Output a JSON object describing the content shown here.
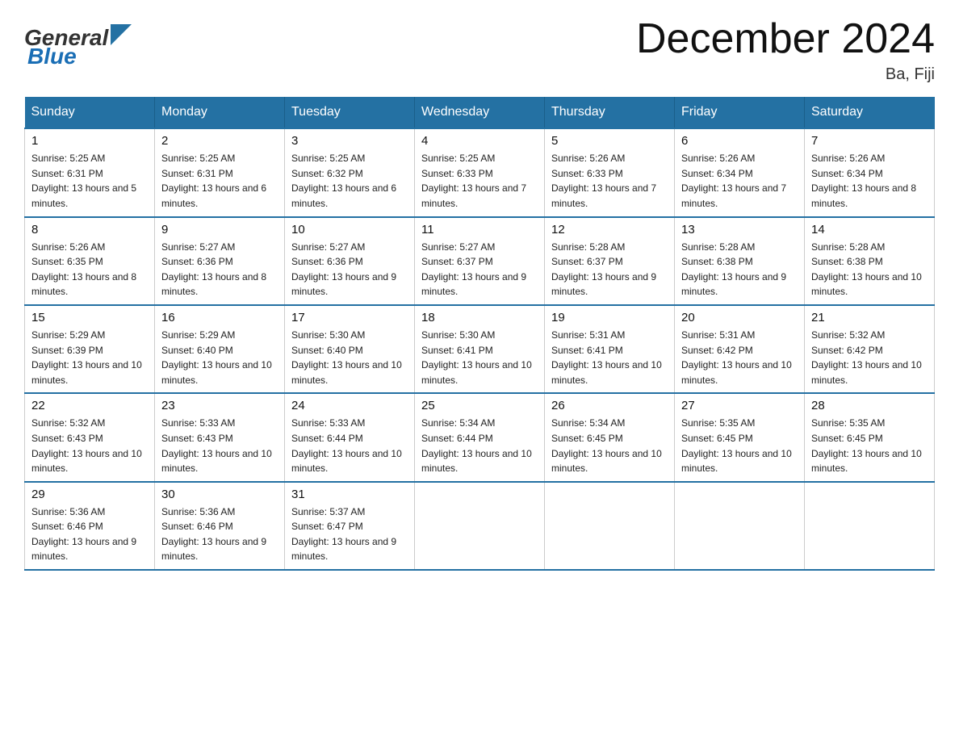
{
  "header": {
    "logo_general": "General",
    "logo_blue": "Blue",
    "title": "December 2024",
    "subtitle": "Ba, Fiji"
  },
  "days_of_week": [
    "Sunday",
    "Monday",
    "Tuesday",
    "Wednesday",
    "Thursday",
    "Friday",
    "Saturday"
  ],
  "weeks": [
    [
      {
        "day": "1",
        "sunrise": "5:25 AM",
        "sunset": "6:31 PM",
        "daylight": "13 hours and 5 minutes."
      },
      {
        "day": "2",
        "sunrise": "5:25 AM",
        "sunset": "6:31 PM",
        "daylight": "13 hours and 6 minutes."
      },
      {
        "day": "3",
        "sunrise": "5:25 AM",
        "sunset": "6:32 PM",
        "daylight": "13 hours and 6 minutes."
      },
      {
        "day": "4",
        "sunrise": "5:25 AM",
        "sunset": "6:33 PM",
        "daylight": "13 hours and 7 minutes."
      },
      {
        "day": "5",
        "sunrise": "5:26 AM",
        "sunset": "6:33 PM",
        "daylight": "13 hours and 7 minutes."
      },
      {
        "day": "6",
        "sunrise": "5:26 AM",
        "sunset": "6:34 PM",
        "daylight": "13 hours and 7 minutes."
      },
      {
        "day": "7",
        "sunrise": "5:26 AM",
        "sunset": "6:34 PM",
        "daylight": "13 hours and 8 minutes."
      }
    ],
    [
      {
        "day": "8",
        "sunrise": "5:26 AM",
        "sunset": "6:35 PM",
        "daylight": "13 hours and 8 minutes."
      },
      {
        "day": "9",
        "sunrise": "5:27 AM",
        "sunset": "6:36 PM",
        "daylight": "13 hours and 8 minutes."
      },
      {
        "day": "10",
        "sunrise": "5:27 AM",
        "sunset": "6:36 PM",
        "daylight": "13 hours and 9 minutes."
      },
      {
        "day": "11",
        "sunrise": "5:27 AM",
        "sunset": "6:37 PM",
        "daylight": "13 hours and 9 minutes."
      },
      {
        "day": "12",
        "sunrise": "5:28 AM",
        "sunset": "6:37 PM",
        "daylight": "13 hours and 9 minutes."
      },
      {
        "day": "13",
        "sunrise": "5:28 AM",
        "sunset": "6:38 PM",
        "daylight": "13 hours and 9 minutes."
      },
      {
        "day": "14",
        "sunrise": "5:28 AM",
        "sunset": "6:38 PM",
        "daylight": "13 hours and 10 minutes."
      }
    ],
    [
      {
        "day": "15",
        "sunrise": "5:29 AM",
        "sunset": "6:39 PM",
        "daylight": "13 hours and 10 minutes."
      },
      {
        "day": "16",
        "sunrise": "5:29 AM",
        "sunset": "6:40 PM",
        "daylight": "13 hours and 10 minutes."
      },
      {
        "day": "17",
        "sunrise": "5:30 AM",
        "sunset": "6:40 PM",
        "daylight": "13 hours and 10 minutes."
      },
      {
        "day": "18",
        "sunrise": "5:30 AM",
        "sunset": "6:41 PM",
        "daylight": "13 hours and 10 minutes."
      },
      {
        "day": "19",
        "sunrise": "5:31 AM",
        "sunset": "6:41 PM",
        "daylight": "13 hours and 10 minutes."
      },
      {
        "day": "20",
        "sunrise": "5:31 AM",
        "sunset": "6:42 PM",
        "daylight": "13 hours and 10 minutes."
      },
      {
        "day": "21",
        "sunrise": "5:32 AM",
        "sunset": "6:42 PM",
        "daylight": "13 hours and 10 minutes."
      }
    ],
    [
      {
        "day": "22",
        "sunrise": "5:32 AM",
        "sunset": "6:43 PM",
        "daylight": "13 hours and 10 minutes."
      },
      {
        "day": "23",
        "sunrise": "5:33 AM",
        "sunset": "6:43 PM",
        "daylight": "13 hours and 10 minutes."
      },
      {
        "day": "24",
        "sunrise": "5:33 AM",
        "sunset": "6:44 PM",
        "daylight": "13 hours and 10 minutes."
      },
      {
        "day": "25",
        "sunrise": "5:34 AM",
        "sunset": "6:44 PM",
        "daylight": "13 hours and 10 minutes."
      },
      {
        "day": "26",
        "sunrise": "5:34 AM",
        "sunset": "6:45 PM",
        "daylight": "13 hours and 10 minutes."
      },
      {
        "day": "27",
        "sunrise": "5:35 AM",
        "sunset": "6:45 PM",
        "daylight": "13 hours and 10 minutes."
      },
      {
        "day": "28",
        "sunrise": "5:35 AM",
        "sunset": "6:45 PM",
        "daylight": "13 hours and 10 minutes."
      }
    ],
    [
      {
        "day": "29",
        "sunrise": "5:36 AM",
        "sunset": "6:46 PM",
        "daylight": "13 hours and 9 minutes."
      },
      {
        "day": "30",
        "sunrise": "5:36 AM",
        "sunset": "6:46 PM",
        "daylight": "13 hours and 9 minutes."
      },
      {
        "day": "31",
        "sunrise": "5:37 AM",
        "sunset": "6:47 PM",
        "daylight": "13 hours and 9 minutes."
      },
      null,
      null,
      null,
      null
    ]
  ],
  "labels": {
    "sunrise": "Sunrise:",
    "sunset": "Sunset:",
    "daylight": "Daylight:"
  }
}
